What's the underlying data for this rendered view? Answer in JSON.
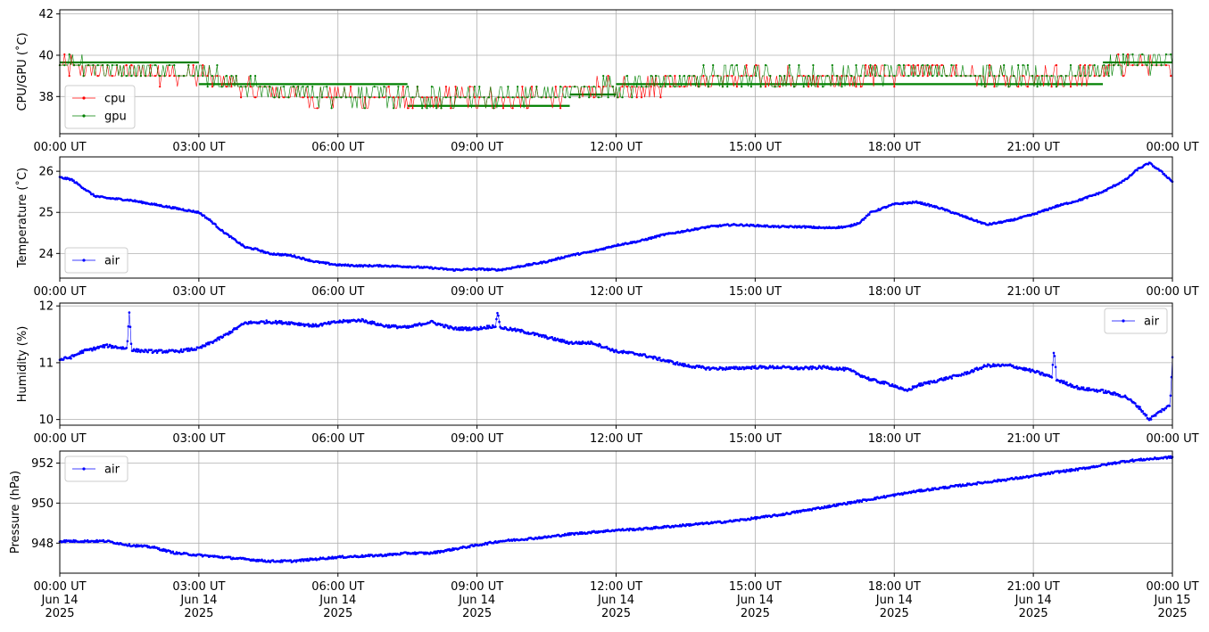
{
  "chart_data": [
    {
      "type": "line",
      "ylabel": "CPU/GPU (˚C)",
      "ylim": [
        36.2,
        42.2
      ],
      "yticks": [
        38,
        40,
        42
      ],
      "xlim": [
        "2025-06-14T00:00",
        "2025-06-15T00:00"
      ],
      "xtick_labels": [
        "00:00 UT",
        "03:00 UT",
        "06:00 UT",
        "09:00 UT",
        "12:00 UT",
        "15:00 UT",
        "18:00 UT",
        "21:00 UT",
        "00:00 UT"
      ],
      "grid": true,
      "legend_position": "lower-left",
      "series": [
        {
          "name": "cpu",
          "color": "#ff0000",
          "x_hours": [
            0,
            0.5,
            1,
            1.5,
            2,
            2.5,
            3,
            3.5,
            4,
            4.5,
            5,
            5.5,
            6,
            6.5,
            7,
            7.5,
            8,
            8.5,
            9,
            9.5,
            10,
            10.5,
            11,
            11.5,
            12,
            12.5,
            13,
            13.5,
            14,
            14.5,
            15,
            15.5,
            16,
            16.5,
            17,
            17.5,
            18,
            18.5,
            19,
            19.5,
            20,
            20.5,
            21,
            21.5,
            22,
            22.5,
            23,
            23.5,
            24
          ],
          "values": [
            39.6,
            39.4,
            39.2,
            39.1,
            39.2,
            39.0,
            39.1,
            38.8,
            38.4,
            38.2,
            38.1,
            38.0,
            38.0,
            37.9,
            37.9,
            37.8,
            37.8,
            37.9,
            38.0,
            37.8,
            37.9,
            38.0,
            38.2,
            38.3,
            38.4,
            38.5,
            38.6,
            38.7,
            38.8,
            38.9,
            38.9,
            38.9,
            38.8,
            38.8,
            38.9,
            39.0,
            39.1,
            39.2,
            39.2,
            39.1,
            38.9,
            38.8,
            38.8,
            38.9,
            39.0,
            39.2,
            39.6,
            39.5,
            39.2
          ]
        },
        {
          "name": "gpu",
          "color": "#008000",
          "x_hours": [
            0,
            0.5,
            1,
            1.5,
            2,
            2.5,
            3,
            3.5,
            4,
            4.5,
            5,
            5.5,
            6,
            6.5,
            7,
            7.5,
            8,
            8.5,
            9,
            9.5,
            10,
            10.5,
            11,
            11.5,
            12,
            12.5,
            13,
            13.5,
            14,
            14.5,
            15,
            15.5,
            16,
            16.5,
            17,
            17.5,
            18,
            18.5,
            19,
            19.5,
            20,
            20.5,
            21,
            21.5,
            22,
            22.5,
            23,
            23.5,
            24
          ],
          "values": [
            39.7,
            39.6,
            39.4,
            39.3,
            39.3,
            39.2,
            39.2,
            38.9,
            38.5,
            38.4,
            38.2,
            38.1,
            38.1,
            38.0,
            38.0,
            37.9,
            37.9,
            38.0,
            38.1,
            38.0,
            38.0,
            38.1,
            38.3,
            38.4,
            38.5,
            38.6,
            38.7,
            38.8,
            38.9,
            39.0,
            39.0,
            39.0,
            38.9,
            38.9,
            39.0,
            39.1,
            39.2,
            39.3,
            39.3,
            39.2,
            39.0,
            38.9,
            38.9,
            39.0,
            39.1,
            39.3,
            39.7,
            39.6,
            39.7
          ]
        }
      ],
      "reference_lines": [
        {
          "color": "#008000",
          "value": 39.65,
          "x_start_hours": 0,
          "x_end_hours": 3.0
        },
        {
          "color": "#008000",
          "value": 38.6,
          "x_start_hours": 3.0,
          "x_end_hours": 7.5
        },
        {
          "color": "#008000",
          "value": 37.55,
          "x_start_hours": 7.5,
          "x_end_hours": 11.0
        },
        {
          "color": "#008000",
          "value": 38.1,
          "x_start_hours": 11.0,
          "x_end_hours": 12.0
        },
        {
          "color": "#008000",
          "value": 38.6,
          "x_start_hours": 12.0,
          "x_end_hours": 17.3
        },
        {
          "color": "#008000",
          "value": 38.6,
          "x_start_hours": 17.3,
          "x_end_hours": 22.5
        },
        {
          "color": "#008000",
          "value": 39.65,
          "x_start_hours": 22.5,
          "x_end_hours": 24.0
        }
      ]
    },
    {
      "type": "line",
      "ylabel": "Temperature (˚C)",
      "ylim": [
        23.4,
        26.35
      ],
      "yticks": [
        24,
        25,
        26
      ],
      "xlim": [
        "2025-06-14T00:00",
        "2025-06-15T00:00"
      ],
      "xtick_labels": [
        "00:00 UT",
        "03:00 UT",
        "06:00 UT",
        "09:00 UT",
        "12:00 UT",
        "15:00 UT",
        "18:00 UT",
        "21:00 UT",
        "00:00 UT"
      ],
      "grid": true,
      "legend_position": "lower-left",
      "series": [
        {
          "name": "air",
          "color": "#0000ff",
          "x_hours": [
            0,
            0.25,
            0.5,
            0.75,
            1,
            1.5,
            2,
            2.5,
            3,
            3.25,
            3.5,
            3.75,
            4,
            4.25,
            4.5,
            5,
            5.5,
            6,
            6.5,
            7,
            7.5,
            8,
            8.5,
            9,
            9.5,
            10,
            10.5,
            11,
            11.5,
            12,
            12.5,
            13,
            13.5,
            14,
            14.5,
            15,
            15.5,
            16,
            16.5,
            17,
            17.25,
            17.5,
            18,
            18.5,
            19,
            19.5,
            20,
            20.5,
            21,
            21.5,
            22,
            22.5,
            23,
            23.25,
            23.5,
            23.75,
            24
          ],
          "values": [
            25.85,
            25.8,
            25.6,
            25.4,
            25.35,
            25.3,
            25.2,
            25.1,
            25.0,
            24.8,
            24.55,
            24.35,
            24.15,
            24.1,
            24.0,
            23.95,
            23.8,
            23.72,
            23.7,
            23.7,
            23.68,
            23.65,
            23.6,
            23.62,
            23.6,
            23.7,
            23.8,
            23.95,
            24.05,
            24.2,
            24.3,
            24.45,
            24.55,
            24.65,
            24.7,
            24.68,
            24.65,
            24.65,
            24.62,
            24.65,
            24.75,
            25.0,
            25.2,
            25.25,
            25.1,
            24.9,
            24.7,
            24.8,
            24.95,
            25.15,
            25.3,
            25.5,
            25.8,
            26.05,
            26.2,
            26.0,
            25.75
          ]
        }
      ]
    },
    {
      "type": "line",
      "ylabel": "Humidity (%)",
      "ylim": [
        9.9,
        12.05
      ],
      "yticks": [
        10,
        11,
        12
      ],
      "xlim": [
        "2025-06-14T00:00",
        "2025-06-15T00:00"
      ],
      "xtick_labels": [
        "00:00 UT",
        "03:00 UT",
        "06:00 UT",
        "09:00 UT",
        "12:00 UT",
        "15:00 UT",
        "18:00 UT",
        "21:00 UT",
        "00:00 UT"
      ],
      "grid": true,
      "legend_position": "upper-right",
      "series": [
        {
          "name": "air",
          "color": "#0000ff",
          "x_hours": [
            0,
            0.25,
            0.5,
            1,
            1.45,
            1.5,
            1.55,
            2,
            2.5,
            3,
            3.5,
            4,
            4.5,
            5,
            5.5,
            6,
            6.5,
            7,
            7.5,
            8,
            8.5,
            9,
            9.4,
            9.45,
            9.5,
            10,
            10.5,
            11,
            11.5,
            12,
            12.5,
            13,
            13.5,
            14,
            14.5,
            15,
            15.5,
            16,
            16.5,
            17,
            17.5,
            18,
            18.25,
            18.5,
            19,
            19.5,
            20,
            20.5,
            21,
            21.4,
            21.45,
            21.5,
            22,
            22.5,
            23,
            23.3,
            23.5,
            23.75,
            23.95,
            24
          ],
          "values": [
            11.05,
            11.1,
            11.2,
            11.3,
            11.25,
            11.9,
            11.22,
            11.2,
            11.2,
            11.25,
            11.45,
            11.7,
            11.72,
            11.7,
            11.65,
            11.72,
            11.75,
            11.65,
            11.62,
            11.72,
            11.6,
            11.6,
            11.65,
            11.9,
            11.62,
            11.55,
            11.45,
            11.35,
            11.35,
            11.2,
            11.15,
            11.05,
            10.95,
            10.9,
            10.9,
            10.92,
            10.92,
            10.9,
            10.92,
            10.88,
            10.7,
            10.6,
            10.5,
            10.6,
            10.7,
            10.8,
            10.95,
            10.95,
            10.85,
            10.75,
            11.25,
            10.7,
            10.55,
            10.5,
            10.4,
            10.2,
            10.0,
            10.15,
            10.25,
            11.1
          ]
        }
      ]
    },
    {
      "type": "line",
      "ylabel": "Pressure (hPa)",
      "ylim": [
        946.5,
        952.6
      ],
      "yticks": [
        948,
        950,
        952
      ],
      "xlim": [
        "2025-06-14T00:00",
        "2025-06-15T00:00"
      ],
      "xtick_labels": [
        "00:00 UT\nJun 14\n2025",
        "03:00 UT\nJun 14\n2025",
        "06:00 UT\nJun 14\n2025",
        "09:00 UT\nJun 14\n2025",
        "12:00 UT\nJun 14\n2025",
        "15:00 UT\nJun 14\n2025",
        "18:00 UT\nJun 14\n2025",
        "21:00 UT\nJun 14\n2025",
        "00:00 UT\nJun 15\n2025"
      ],
      "grid": true,
      "legend_position": "upper-left",
      "series": [
        {
          "name": "air",
          "color": "#0000ff",
          "x_hours": [
            0,
            0.5,
            1,
            1.5,
            2,
            2.5,
            3,
            3.5,
            4,
            4.5,
            5,
            5.5,
            6,
            6.5,
            7,
            7.5,
            8,
            8.5,
            9,
            9.5,
            10,
            10.5,
            11,
            11.5,
            12,
            12.5,
            13,
            13.5,
            14,
            14.5,
            15,
            15.5,
            16,
            16.5,
            17,
            17.5,
            18,
            18.5,
            19,
            19.5,
            20,
            20.5,
            21,
            21.5,
            22,
            22.5,
            23,
            23.5,
            24
          ],
          "values": [
            948.1,
            948.1,
            948.1,
            947.9,
            947.8,
            947.5,
            947.4,
            947.3,
            947.2,
            947.1,
            947.1,
            947.2,
            947.3,
            947.35,
            947.4,
            947.5,
            947.5,
            947.7,
            947.9,
            948.1,
            948.2,
            948.3,
            948.45,
            948.55,
            948.65,
            948.7,
            948.8,
            948.9,
            949.0,
            949.1,
            949.25,
            949.4,
            949.6,
            949.8,
            950.0,
            950.2,
            950.4,
            950.6,
            950.75,
            950.9,
            951.05,
            951.2,
            951.35,
            951.55,
            951.7,
            951.9,
            952.1,
            952.2,
            952.3
          ]
        }
      ]
    }
  ]
}
